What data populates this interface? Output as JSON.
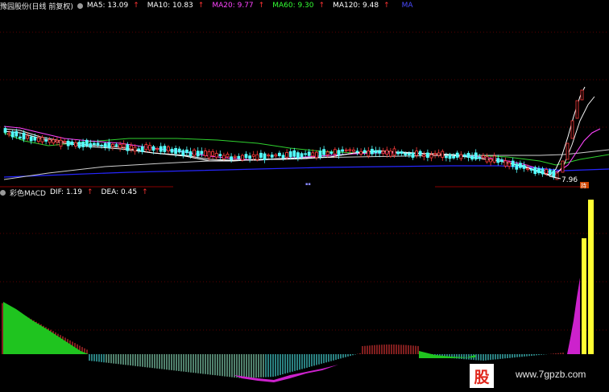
{
  "kline_panel": {
    "title": "豫园股份(日线 前复权)",
    "ma_items": [
      {
        "label": "MA5: 13.09",
        "color": "#ffffff"
      },
      {
        "label": "MA10: 10.83",
        "color": "#ffffff"
      },
      {
        "label": "MA20: 9.77",
        "color": "#ff44ff"
      },
      {
        "label": "MA60: 9.30",
        "color": "#33ff33"
      },
      {
        "label": "MA120: 9.48",
        "color": "#ffffff"
      }
    ],
    "overflow_label": "MA",
    "low_price_label": "7.96",
    "marker_label": "持"
  },
  "macd_panel": {
    "title": "彩色MACD",
    "dif_label": "DIF: 1.19",
    "dea_label": "DEA: 0.45"
  },
  "watermark": {
    "logo_text": "股",
    "url": "www.7gpzb.com"
  },
  "colors": {
    "background": "#000000",
    "up_arrow": "#ff3333",
    "up_candle": "#ff3b3b",
    "down_candle": "#54ffff",
    "grid": "#6b0000",
    "ma120": "#2626ff"
  }
}
